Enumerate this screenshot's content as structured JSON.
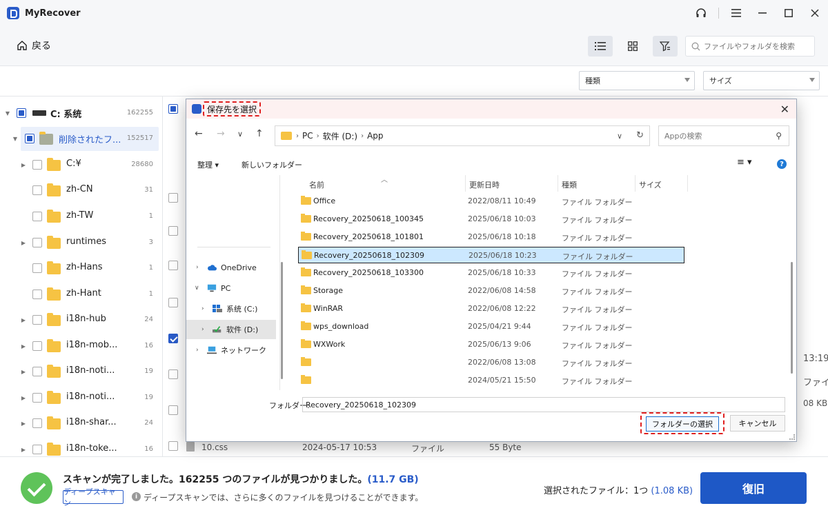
{
  "app": {
    "title": "MyRecover"
  },
  "toolbar": {
    "back_label": "戻る",
    "search_placeholder": "ファイルやフォルダを検索"
  },
  "filters": {
    "type_label": "種類",
    "size_label": "サイズ"
  },
  "sidebar": {
    "items": [
      {
        "label": "C: 系统",
        "count": "162255"
      },
      {
        "label": "削除されたフ...",
        "count": "152517"
      },
      {
        "label": "C:¥",
        "count": "28680"
      },
      {
        "label": "zh-CN",
        "count": "31"
      },
      {
        "label": "zh-TW",
        "count": "1"
      },
      {
        "label": "runtimes",
        "count": "3"
      },
      {
        "label": "zh-Hans",
        "count": "1"
      },
      {
        "label": "zh-Hant",
        "count": "1"
      },
      {
        "label": "i18n-hub",
        "count": "24"
      },
      {
        "label": "i18n-mob...",
        "count": "16"
      },
      {
        "label": "i18n-noti...",
        "count": "19"
      },
      {
        "label": "i18n-noti...",
        "count": "19"
      },
      {
        "label": "i18n-shar...",
        "count": "24"
      },
      {
        "label": "i18n-toke...",
        "count": "16"
      }
    ]
  },
  "background": {
    "peek_time": "13:19",
    "peek_type": "ファイル",
    "peek_size": "08 KB",
    "bottom_row": {
      "name": "10.css",
      "date": "2024-05-17 10:53",
      "type": "ファイル",
      "size": "55 Byte"
    }
  },
  "bottom": {
    "scan_message": "スキャンが完了しました。162255 つのファイルが見つかりました。",
    "scan_size": "(11.7 GB)",
    "deep_scan_label": "ディープスキャン",
    "deep_scan_hint": "ディープスキャンでは、さらに多くのファイルを見つけることができます。",
    "selected_label": "選択されたファイル：1つ",
    "selected_size": "(1.08 KB)",
    "recover_label": "復旧"
  },
  "dialog": {
    "title": "保存先を選択",
    "breadcrumb": [
      "PC",
      "软件 (D:)",
      "App"
    ],
    "search_placeholder": "Appの検索",
    "organize_label": "整理",
    "new_folder_label": "新しいフォルダー",
    "nav": [
      {
        "label": "OneDrive"
      },
      {
        "label": "PC"
      },
      {
        "label": "系统 (C:)"
      },
      {
        "label": "软件 (D:)"
      },
      {
        "label": "ネットワーク"
      }
    ],
    "columns": {
      "name": "名前",
      "date": "更新日時",
      "type": "種類",
      "size": "サイズ"
    },
    "files": [
      {
        "name": "Office",
        "date": "2022/08/11 10:49",
        "type": "ファイル フォルダー"
      },
      {
        "name": "Recovery_20250618_100345",
        "date": "2025/06/18 10:03",
        "type": "ファイル フォルダー"
      },
      {
        "name": "Recovery_20250618_101801",
        "date": "2025/06/18 10:18",
        "type": "ファイル フォルダー"
      },
      {
        "name": "Recovery_20250618_102309",
        "date": "2025/06/18 10:23",
        "type": "ファイル フォルダー"
      },
      {
        "name": "Recovery_20250618_103300",
        "date": "2025/06/18 10:33",
        "type": "ファイル フォルダー"
      },
      {
        "name": "Storage",
        "date": "2022/06/08 14:58",
        "type": "ファイル フォルダー"
      },
      {
        "name": "WinRAR",
        "date": "2022/06/08 12:22",
        "type": "ファイル フォルダー"
      },
      {
        "name": "wps_download",
        "date": "2025/04/21 9:44",
        "type": "ファイル フォルダー"
      },
      {
        "name": "WXWork",
        "date": "2025/06/13 9:06",
        "type": "ファイル フォルダー"
      },
      {
        "name": "",
        "date": "2022/06/08 13:08",
        "type": "ファイル フォルダー"
      },
      {
        "name": "",
        "date": "2024/05/21 15:50",
        "type": "ファイル フォルダー"
      }
    ],
    "folder_label": "フォルダー:",
    "folder_value": "Recovery_20250618_102309",
    "select_label": "フォルダーの選択",
    "cancel_label": "キャンセル"
  }
}
